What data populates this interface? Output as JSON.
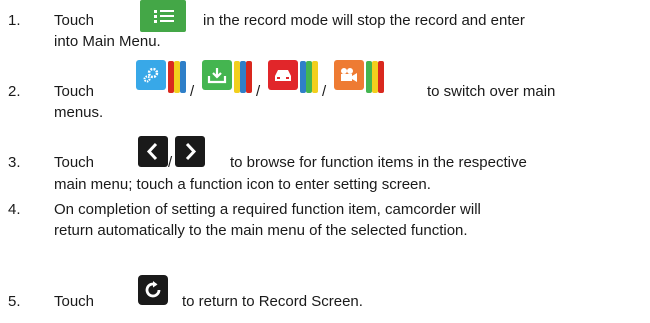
{
  "steps": [
    {
      "number": "1.",
      "before": "Touch",
      "after_icon": "in the record mode will stop the record and enter",
      "line2": "into Main Menu.",
      "icon": "menu-list-icon"
    },
    {
      "number": "2.",
      "before": "Touch",
      "separator": "/",
      "after_icons": "to switch over main",
      "line2": "menus.",
      "icons": [
        "settings-gear-icon",
        "download-export-icon",
        "car-icon",
        "video-camera-icon"
      ]
    },
    {
      "number": "3.",
      "before": "Touch",
      "separator": "/",
      "after_icons": "to browse for function items in the respective",
      "line2": "main menu; touch a function icon to enter setting screen.",
      "icons": [
        "chevron-left-icon",
        "chevron-right-icon"
      ]
    },
    {
      "number": "4.",
      "line1": "On completion of setting a required function item, camcorder will",
      "line2": "return automatically to the main menu of the selected function."
    },
    {
      "number": "5.",
      "before": "Touch",
      "after_icon": "to return to Record Screen.",
      "icon": "return-arrow-icon"
    }
  ],
  "colors": {
    "menu_green": "#44a747",
    "tile_blue": "#38a8e8",
    "tile_green": "#44b550",
    "tile_red": "#e1262a",
    "tile_orange": "#ee7b33",
    "stripe_yellow": "#f2cf1d",
    "stripe_blue": "#2f7fc8",
    "stripe_red": "#d9281e",
    "dark_button": "#1a1a1a"
  }
}
